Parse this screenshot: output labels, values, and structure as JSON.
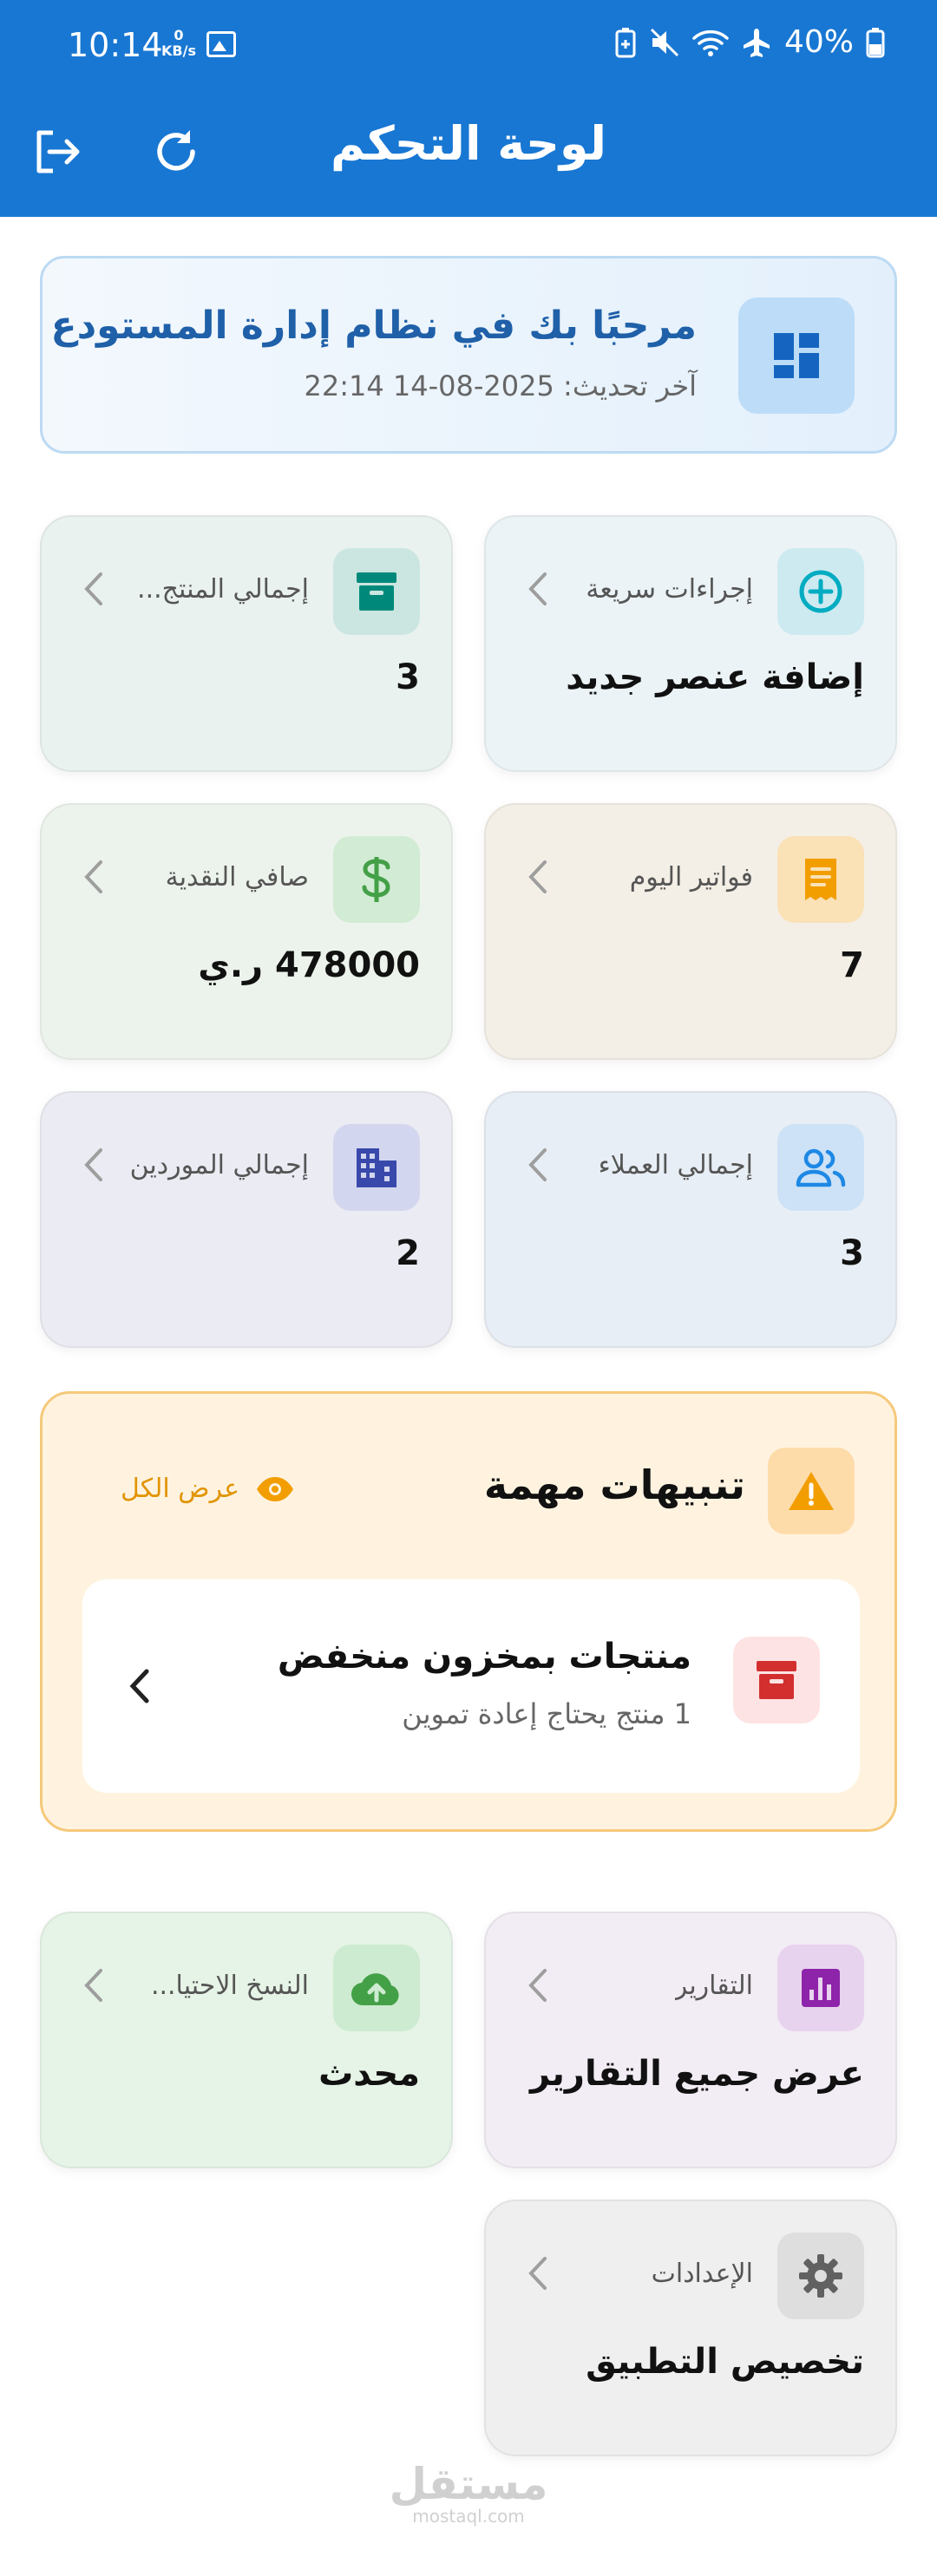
{
  "status_bar": {
    "time": "10:14",
    "net_speed_value": "0",
    "net_speed_unit": "KB/s",
    "battery": "40%"
  },
  "header": {
    "title": "لوحة التحكم"
  },
  "welcome": {
    "title": "مرحبًا بك في نظام إدارة المستودع",
    "last_update": "آخر تحديث: 2025-08-14 22:14"
  },
  "cards": {
    "quick_actions": {
      "label": "إجراءات سريعة",
      "value": "إضافة عنصر جديد",
      "color": "#00acc1"
    },
    "total_products": {
      "label": "إجمالي المنتج...",
      "value": "3",
      "color": "#00897b"
    },
    "today_invoices": {
      "label": "فواتير اليوم",
      "value": "7",
      "color": "#f29d00"
    },
    "net_cash": {
      "label": "صافي النقدية",
      "value": "478000 ر.ي",
      "color": "#43a047"
    },
    "total_customers": {
      "label": "إجمالي العملاء",
      "value": "3",
      "color": "#1e88e5"
    },
    "total_suppliers": {
      "label": "إجمالي الموردين",
      "value": "2",
      "color": "#3949ab"
    },
    "reports": {
      "label": "التقارير",
      "value": "عرض جميع التقارير",
      "color": "#8e24aa"
    },
    "backup": {
      "label": "النسخ الاحتيا...",
      "value": "محدث",
      "color": "#43a047"
    },
    "settings": {
      "label": "الإعدادات",
      "value": "تخصيص التطبيق",
      "color": "#616161"
    }
  },
  "alerts": {
    "title": "تنبيهات مهمة",
    "view_all": "عرض الكل",
    "items": [
      {
        "title": "منتجات بمخزون منخفض",
        "subtitle": "1 منتج يحتاج إعادة تموين"
      }
    ]
  },
  "watermark": {
    "main": "مستقل",
    "sub": "mostaql.com"
  },
  "colors": {
    "primary": "#1877d3",
    "alert_accent": "#f29d00",
    "danger": "#d32f2f"
  }
}
